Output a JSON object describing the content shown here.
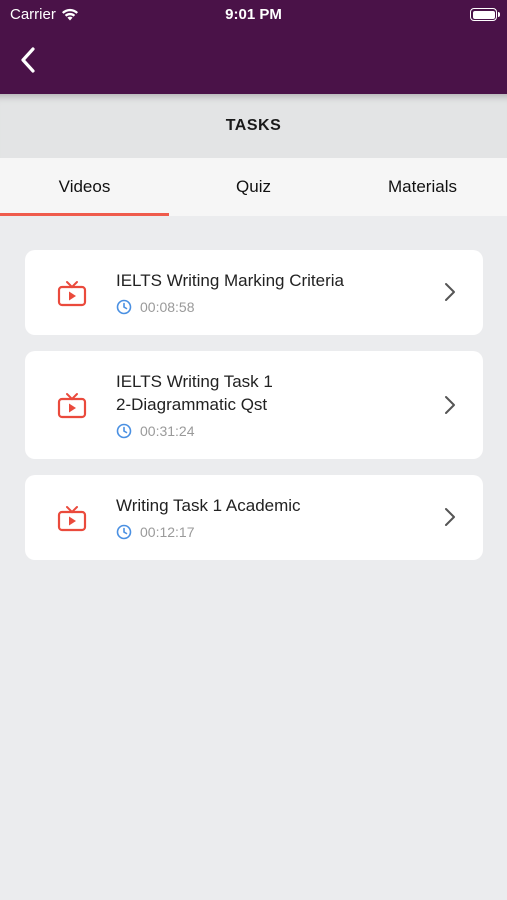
{
  "status_bar": {
    "carrier": "Carrier",
    "time": "9:01 PM"
  },
  "nav": {
    "back_icon": "chevron-left-icon"
  },
  "header": {
    "title": "TASKS"
  },
  "tabs": [
    {
      "label": "Videos",
      "active": true
    },
    {
      "label": "Quiz",
      "active": false
    },
    {
      "label": "Materials",
      "active": false
    }
  ],
  "videos": [
    {
      "title": "IELTS Writing Marking Criteria",
      "duration": "00:08:58",
      "icon": "tv-play-icon"
    },
    {
      "title": "IELTS Writing Task 1\n2-Diagrammatic Qst",
      "duration": "00:31:24",
      "icon": "tv-play-icon"
    },
    {
      "title": "Writing Task 1 Academic",
      "duration": "00:12:17",
      "icon": "tv-play-icon"
    }
  ],
  "colors": {
    "brand": "#4a1248",
    "accent": "#ef5b4c",
    "clock": "#4a90e2"
  }
}
